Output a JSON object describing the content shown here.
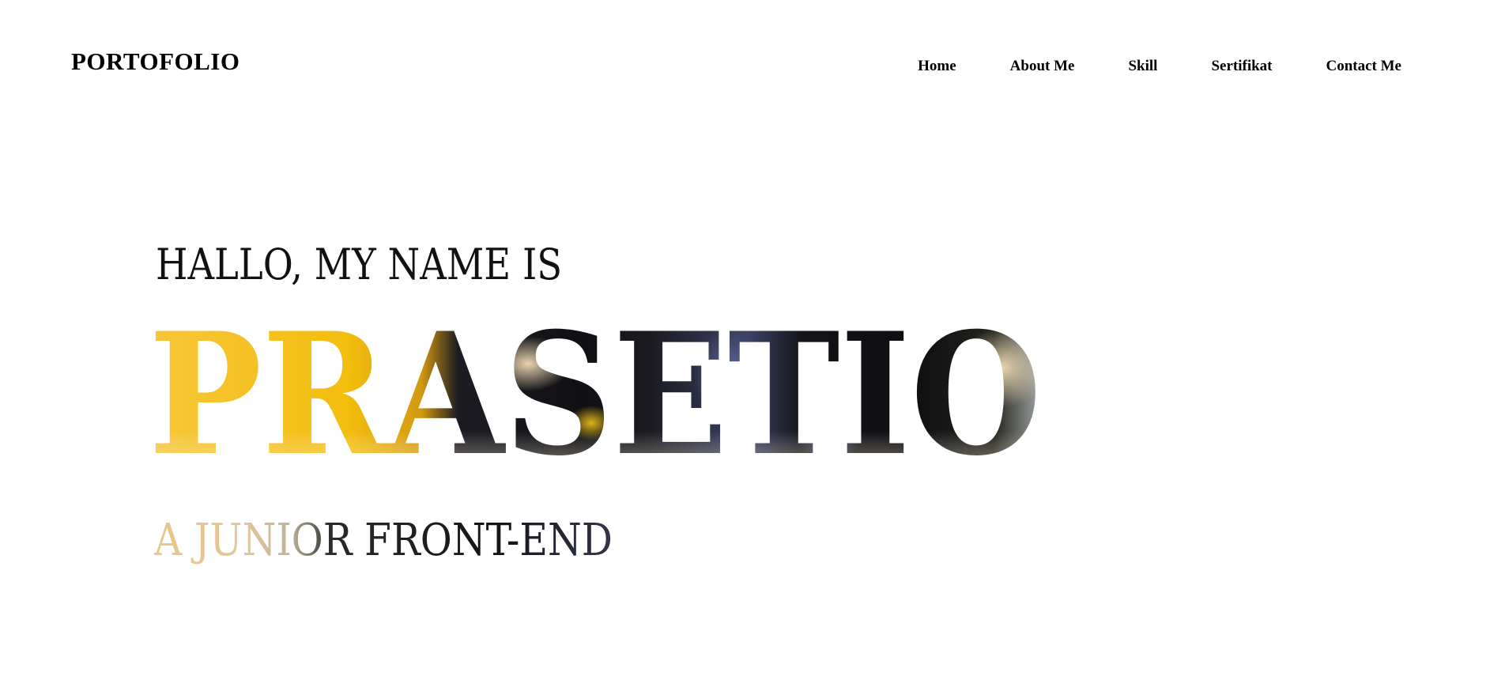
{
  "header": {
    "logo": "PORTOFOLIO",
    "nav": [
      {
        "label": "Home"
      },
      {
        "label": "About Me"
      },
      {
        "label": "Skill"
      },
      {
        "label": "Sertifikat"
      },
      {
        "label": "Contact Me"
      }
    ]
  },
  "hero": {
    "greeting": "HALLO, MY NAME IS",
    "name": "PRASETIO",
    "role": "A JUNIOR FRONT-END"
  },
  "colors": {
    "accent_yellow": "#f5c518",
    "paint_dark": "#15151c",
    "paint_blue": "#4b4f77",
    "paint_cream": "#f3ddb5"
  }
}
